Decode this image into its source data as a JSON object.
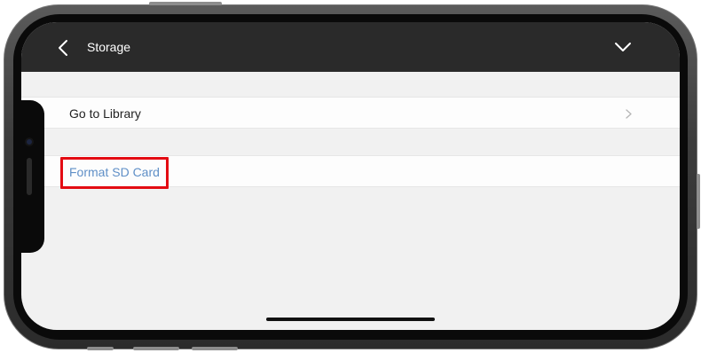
{
  "nav": {
    "title": "Storage",
    "back_icon": "chevron-left-icon",
    "collapse_icon": "chevron-down-icon"
  },
  "rows": [
    {
      "label": "Go to Library",
      "icon": "chevron-right-icon"
    },
    {
      "label": "Format SD Card"
    }
  ],
  "colors": {
    "nav_background": "#2a2a2a",
    "screen_background": "#f1f1f1",
    "link": "#5f8fc7",
    "highlight": "#e30b12"
  }
}
